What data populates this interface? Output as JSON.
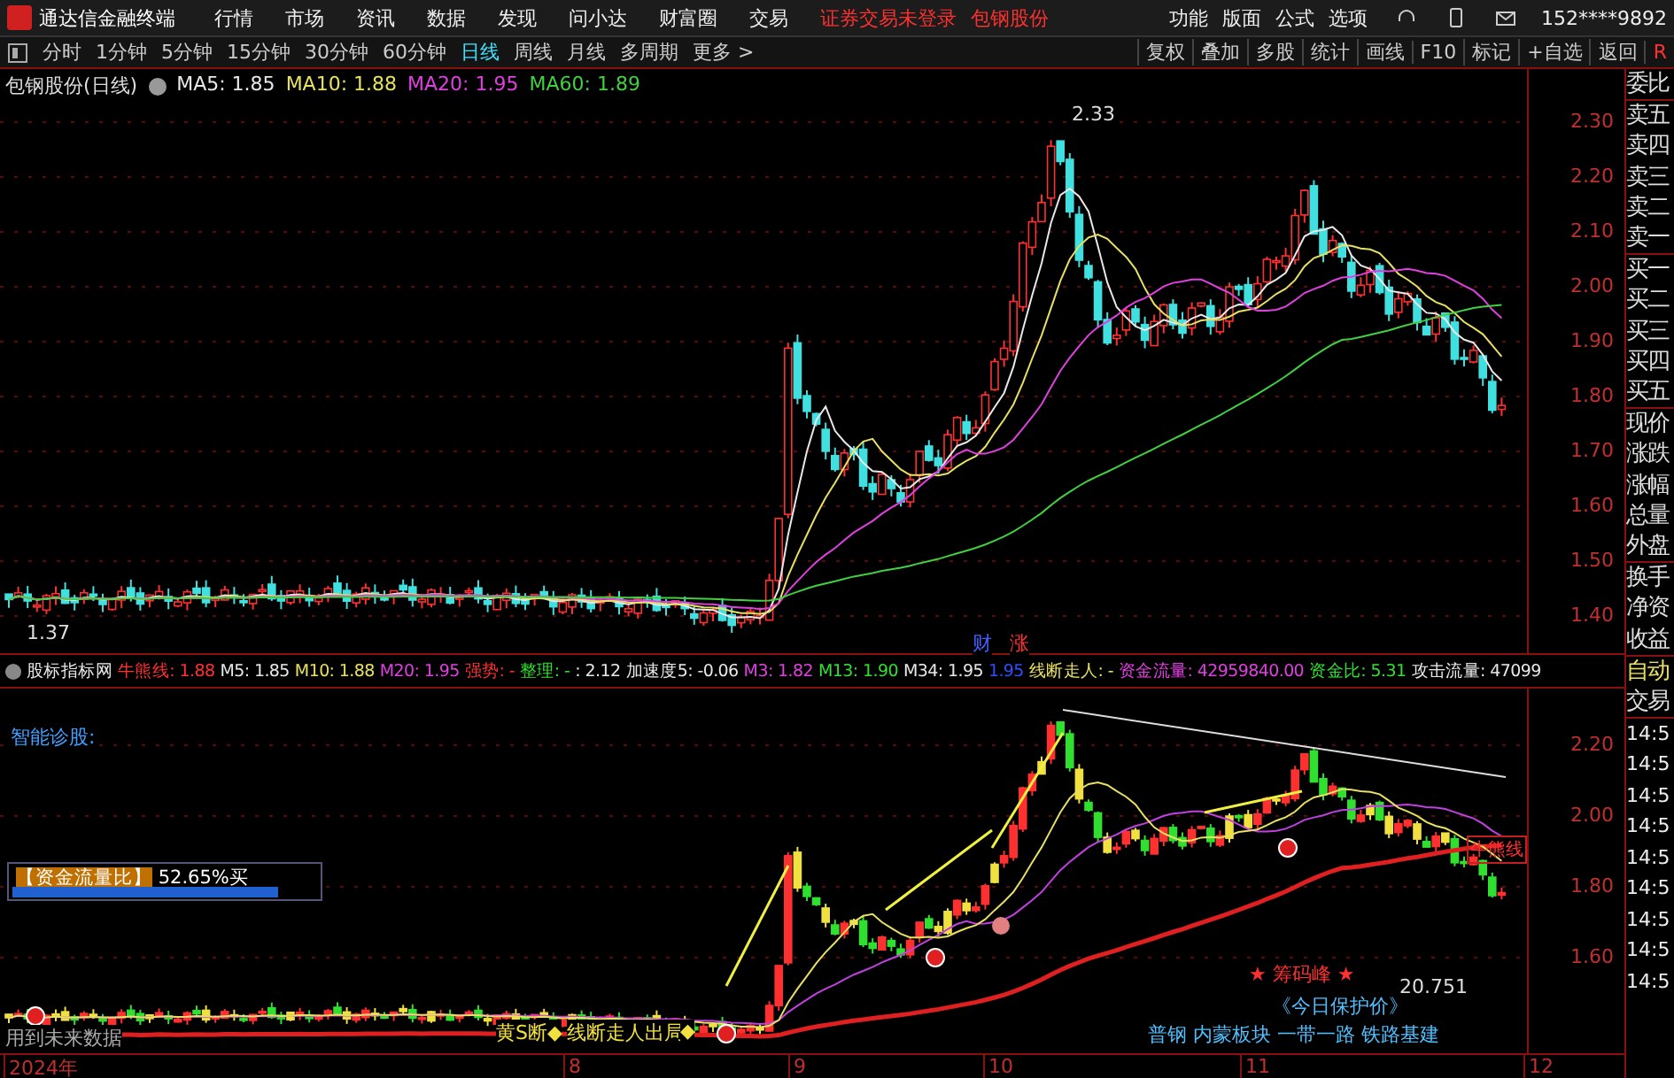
{
  "app_title": "通达信金融终端",
  "menu": [
    {
      "label": "行情"
    },
    {
      "label": "市场"
    },
    {
      "label": "资讯"
    },
    {
      "label": "数据"
    },
    {
      "label": "发现"
    },
    {
      "label": "问小达"
    },
    {
      "label": "财富圈"
    },
    {
      "label": "交易"
    }
  ],
  "login_notice": "证券交易未登录",
  "stock_name": "包钢股份",
  "tools_menu": [
    {
      "label": "功能"
    },
    {
      "label": "版面"
    },
    {
      "label": "公式"
    },
    {
      "label": "选项"
    }
  ],
  "account": "152****9892",
  "periods": [
    {
      "label": "分时",
      "selected": false
    },
    {
      "label": "1分钟",
      "selected": false
    },
    {
      "label": "5分钟",
      "selected": false
    },
    {
      "label": "15分钟",
      "selected": false
    },
    {
      "label": "30分钟",
      "selected": false
    },
    {
      "label": "60分钟",
      "selected": false
    },
    {
      "label": "日线",
      "selected": true
    },
    {
      "label": "周线",
      "selected": false
    },
    {
      "label": "月线",
      "selected": false
    },
    {
      "label": "多周期",
      "selected": false
    },
    {
      "label": "更多 >",
      "selected": false
    }
  ],
  "chart_tools": [
    {
      "label": "复权"
    },
    {
      "label": "叠加"
    },
    {
      "label": "多股"
    },
    {
      "label": "统计"
    },
    {
      "label": "画线"
    },
    {
      "label": "F10"
    },
    {
      "label": "标记"
    },
    {
      "label": "+自选"
    },
    {
      "label": "返回"
    },
    {
      "label": "R"
    }
  ],
  "main_chart": {
    "title": "包钢股份(日线)",
    "legend": [
      {
        "text": "MA5: 1.85",
        "color": "#e8e8e8"
      },
      {
        "text": "MA10: 1.88",
        "color": "#e8e060"
      },
      {
        "text": "MA20: 1.95",
        "color": "#e040e0"
      },
      {
        "text": "MA60: 1.89",
        "color": "#40d040"
      }
    ],
    "high_label": "2.33",
    "low_label": "1.37",
    "flag_labels": [
      "财",
      "涨"
    ],
    "price_axis": [
      "2.30",
      "2.20",
      "2.10",
      "2.00",
      "1.90",
      "1.80",
      "1.70",
      "1.60",
      "1.50",
      "1.40"
    ]
  },
  "indicator": {
    "legend": [
      {
        "text": "股标指标网",
        "color": "#e8e8e8"
      },
      {
        "text": "牛熊线: 1.88",
        "color": "#ff3030"
      },
      {
        "text": "M5: 1.85",
        "color": "#e8e8e8"
      },
      {
        "text": "M10: 1.88",
        "color": "#e8e060"
      },
      {
        "text": "M20: 1.95",
        "color": "#e040e0"
      },
      {
        "text": "强势: -",
        "color": "#ff3030"
      },
      {
        "text": "整理: -",
        "color": "#30e030"
      },
      {
        "text": ": 2.12",
        "color": "#e8e8e8"
      },
      {
        "text": "加速度5: -0.06",
        "color": "#e8e8e8"
      },
      {
        "text": "M3: 1.82",
        "color": "#e040e0"
      },
      {
        "text": "M13: 1.90",
        "color": "#30e030"
      },
      {
        "text": "M34: 1.95",
        "color": "#e8e8e8"
      },
      {
        "text": "1.95",
        "color": "#3050ff"
      },
      {
        "text": "线断走人: -",
        "color": "#e8e060"
      },
      {
        "text": "资金流量: 42959840.00",
        "color": "#e040e0"
      },
      {
        "text": "资金比: 5.31",
        "color": "#30e030"
      },
      {
        "text": "攻击流量: 47099",
        "color": "#e8e8e8"
      }
    ],
    "diagnosis": "智能诊股:",
    "fund_flow": {
      "label": "【资金流量比】",
      "value": "52.65%买",
      "level": 0.87
    },
    "bull_bear_tag": "牛熊线",
    "chip_peak": "★ 筹码峰 ★",
    "chip_value": "20.751",
    "future_data_note": "用到未来数据",
    "signals": [
      "黄S断◆",
      "线断走人出局",
      "◆"
    ],
    "sectors": "普钢 内蒙板块 一带一路 铁路基建",
    "protect_price": "《今日保护价》",
    "price_axis": [
      "2.20",
      "2.00",
      "1.80",
      "1.60"
    ]
  },
  "date_axis": [
    "2024年",
    "8",
    "9",
    "10",
    "11",
    "12"
  ],
  "quote_labels": [
    "委比",
    "卖五",
    "卖四",
    "卖三",
    "卖二",
    "卖一",
    "买一",
    "买二",
    "买三",
    "买四",
    "买五",
    "现价",
    "涨跌",
    "涨幅",
    "总量",
    "外盘",
    "换手",
    "净资",
    "收益"
  ],
  "trade_labels": [
    "自动",
    "交易"
  ],
  "trade_times": [
    "14:5",
    "14:5",
    "14:5",
    "14:5",
    "14:5",
    "14:5",
    "14:5",
    "14:5",
    "14:5"
  ]
}
